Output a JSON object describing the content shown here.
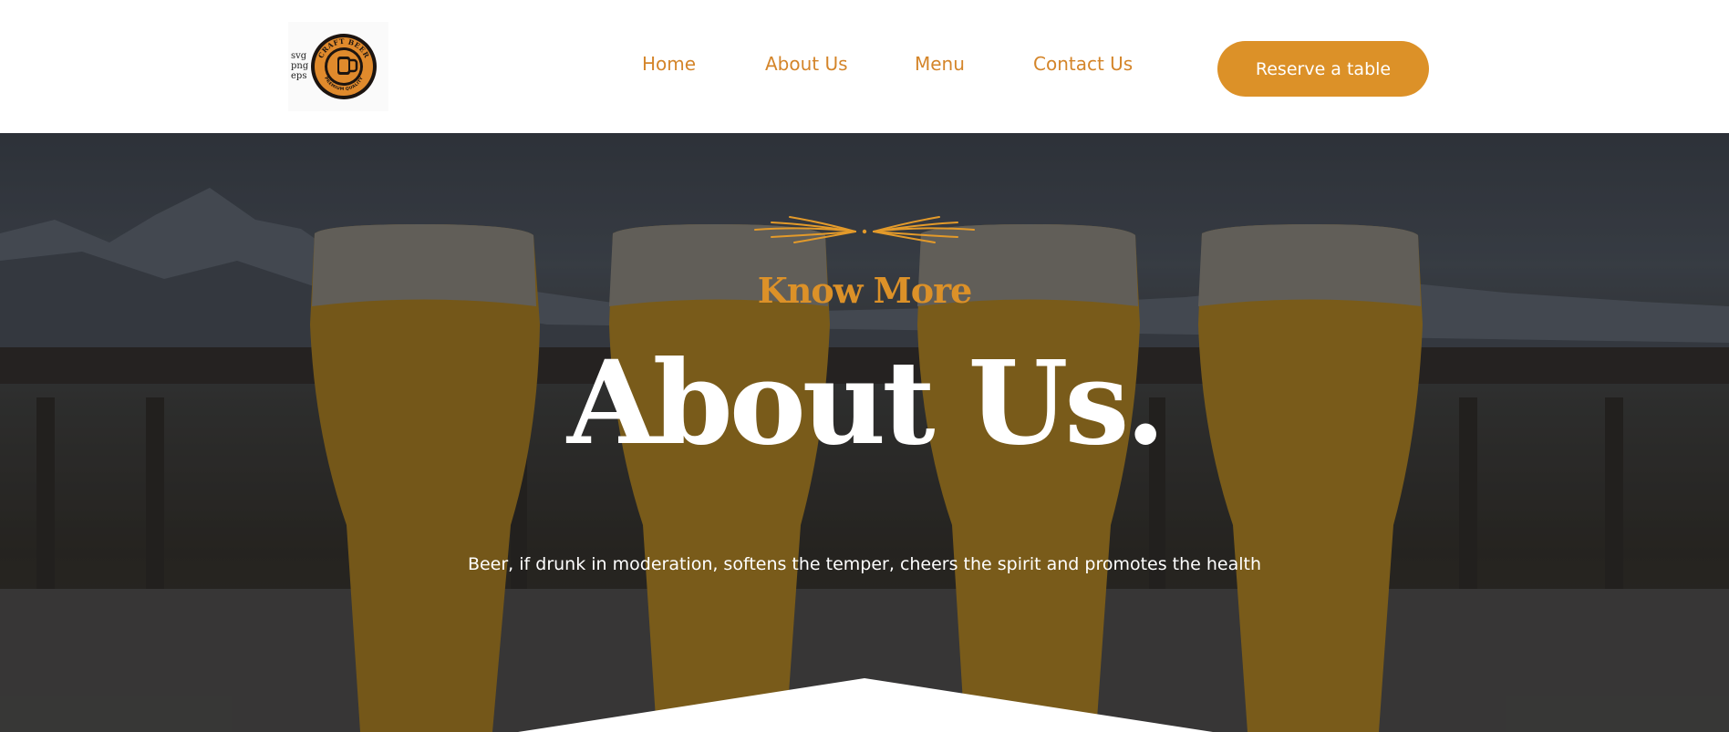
{
  "header": {
    "logo": {
      "formats": [
        "svg",
        "png",
        "eps"
      ],
      "badge_top_text": "CRAFT BEER",
      "badge_bottom_text": "PREMIUM QUALITY"
    },
    "nav": [
      {
        "label": "Home"
      },
      {
        "label": "About Us"
      },
      {
        "label": "Menu"
      },
      {
        "label": "Contact Us"
      }
    ],
    "reserve_label": "Reserve a table"
  },
  "hero": {
    "eyebrow": "Know More",
    "title": "About Us.",
    "tagline": "Beer, if drunk in moderation, softens the temper, cheers the spirit and promotes the health"
  },
  "colors": {
    "accent": "#dc9128",
    "nav_text": "#d4852a",
    "title_text": "#ffffff"
  }
}
